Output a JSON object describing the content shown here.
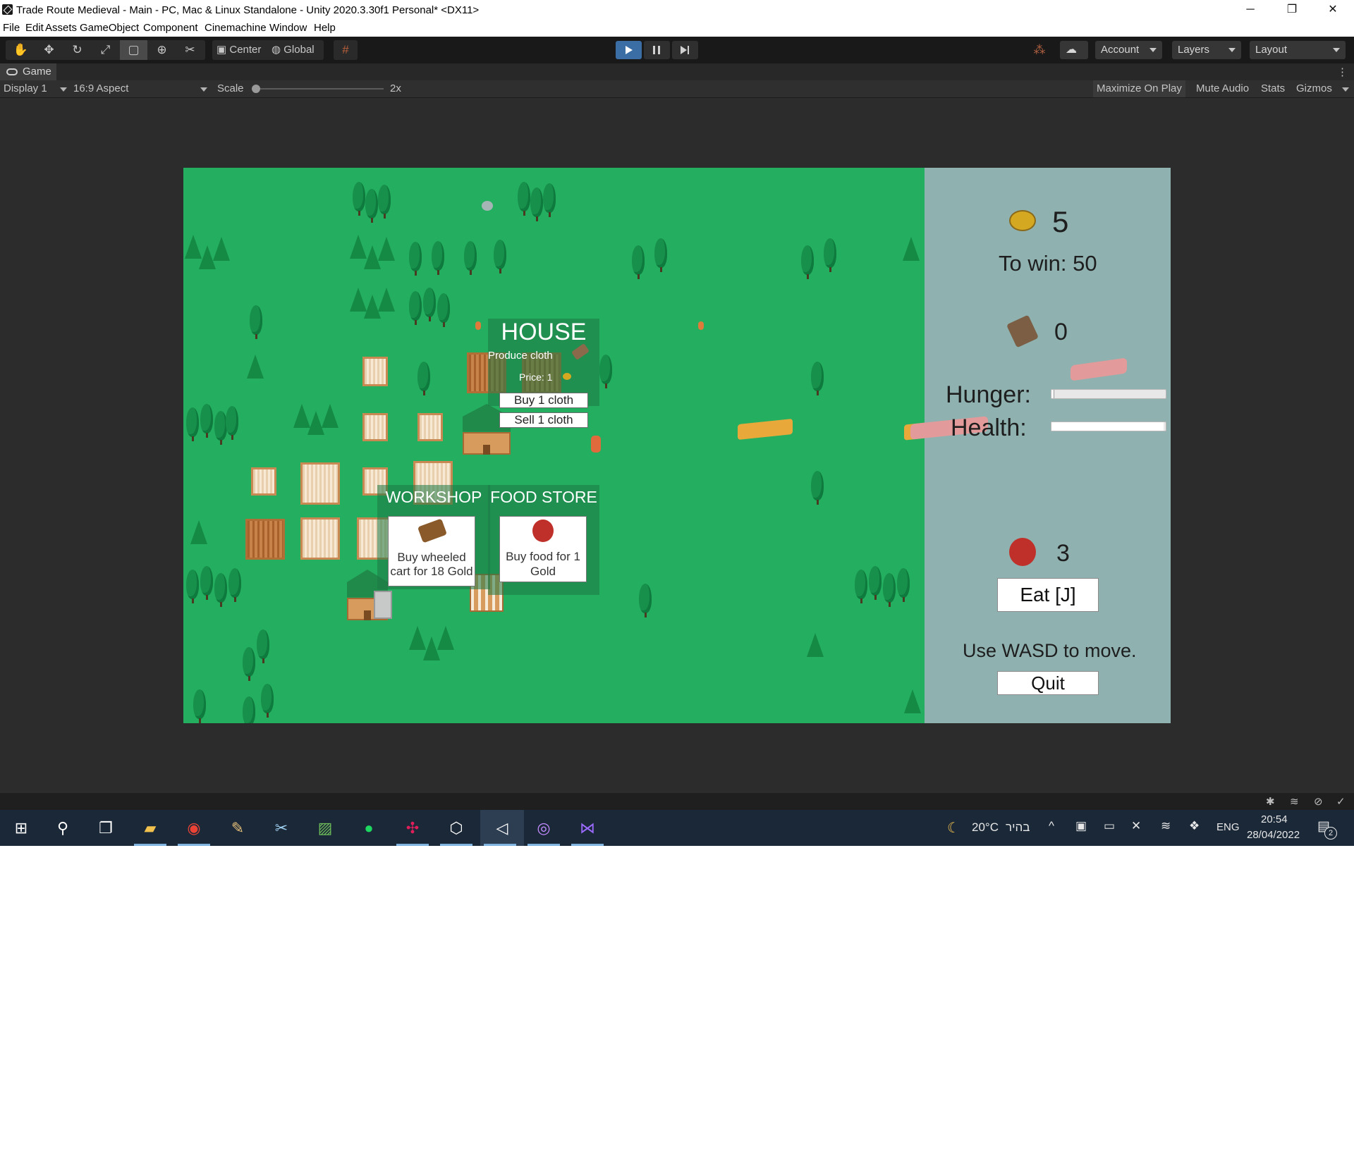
{
  "window": {
    "title": "Trade Route Medieval - Main - PC, Mac & Linux Standalone - Unity 2020.3.30f1 Personal* <DX11>",
    "minimize": "─",
    "restore": "❐",
    "close": "✕"
  },
  "menu": [
    "File",
    "Edit",
    "Assets",
    "GameObject",
    "Component",
    "Cinemachine",
    "Window",
    "Help"
  ],
  "toolbar": {
    "pivot_mode": "Center",
    "pivot_rotation": "Global",
    "account": "Account",
    "layers": "Layers",
    "layout": "Layout"
  },
  "game_view": {
    "tab_label": "Game",
    "display": "Display 1",
    "aspect": "16:9 Aspect",
    "scale_label": "Scale",
    "scale_value": "2x",
    "maximize_on_play": "Maximize On Play",
    "mute_audio": "Mute Audio",
    "stats": "Stats",
    "gizmos": "Gizmos"
  },
  "game": {
    "house": {
      "title": "HOUSE",
      "produce": "Produce cloth",
      "price": "Price: 1",
      "buy": "Buy 1 cloth",
      "sell": "Sell 1 cloth"
    },
    "workshop": {
      "title": "WORKSHOP",
      "card_text": "Buy wheeled cart for 18 Gold"
    },
    "food_store": {
      "title": "FOOD STORE",
      "card_text": "Buy food for 1 Gold"
    },
    "hud": {
      "gold": "5",
      "to_win": "To win: 50",
      "cloth": "0",
      "hunger_label": "Hunger:",
      "hunger_level": 0.02,
      "health_label": "Health:",
      "health_level": 0.98,
      "food": "3",
      "eat_button": "Eat [J]",
      "instructions": "Use WASD to move.",
      "quit_button": "Quit"
    }
  },
  "taskbar": {
    "weather_temp": "20°C",
    "weather_desc": "בהיר",
    "language": "ENG",
    "time": "20:54",
    "date": "28/04/2022",
    "notifications": "2"
  }
}
